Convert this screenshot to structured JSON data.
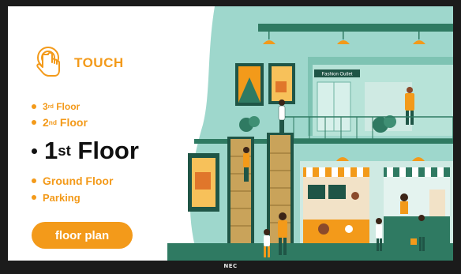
{
  "touch": {
    "label": "TOUCH",
    "icon": "hand-pointer-icon"
  },
  "floors": [
    {
      "num": "3",
      "suffix": "rd",
      "rest": " Floor"
    },
    {
      "num": "2",
      "suffix": "nd",
      "rest": " Floor"
    },
    {
      "num": "1",
      "suffix": "st",
      "rest": " Floor"
    },
    {
      "label": "Ground Floor"
    },
    {
      "label": "Parking"
    }
  ],
  "floor_plan_button": "floor plan",
  "store_sign": "Fashion Outlet",
  "bezel_brand": "NEC",
  "colors": {
    "accent": "#f39a1a",
    "mint": "#9ed7cc",
    "teal": "#2f7a62",
    "dark_teal": "#1f5546"
  }
}
